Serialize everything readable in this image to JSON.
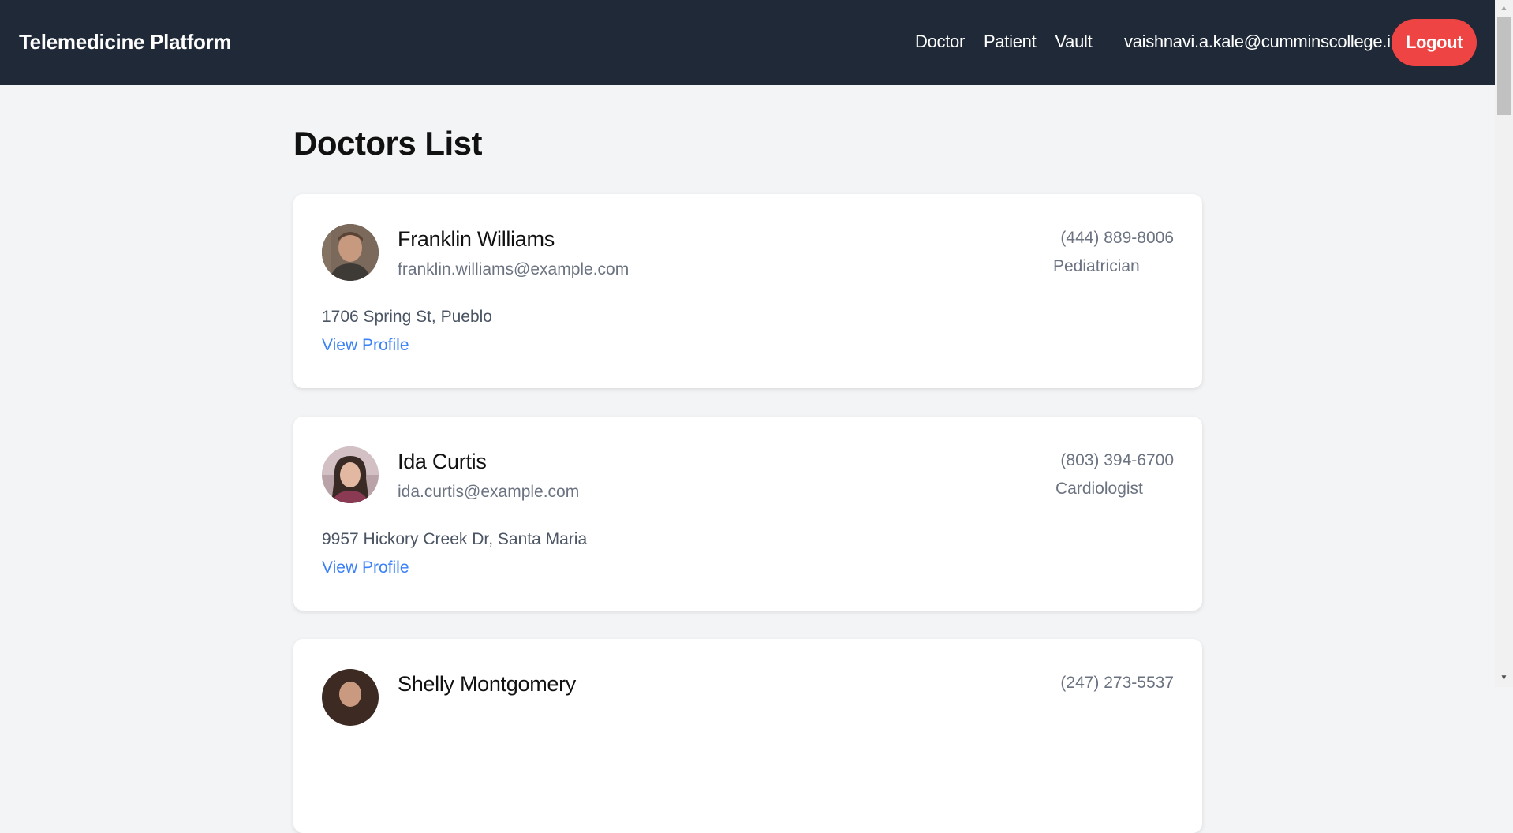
{
  "header": {
    "brand": "Telemedicine Platform",
    "nav": [
      "Doctor",
      "Patient",
      "Vault"
    ],
    "user_email": "vaishnavi.a.kale@cumminscollege.in",
    "logout_label": "Logout"
  },
  "main": {
    "title": "Doctors List",
    "link_label": "View Profile",
    "doctors": [
      {
        "name": "Franklin Williams",
        "email": "franklin.williams@example.com",
        "phone": "(444) 889-8006",
        "specialty": "Pediatrician",
        "address": "1706 Spring St, Pueblo"
      },
      {
        "name": "Ida Curtis",
        "email": "ida.curtis@example.com",
        "phone": "(803) 394-6700",
        "specialty": "Cardiologist",
        "address": "9957 Hickory Creek Dr, Santa Maria"
      },
      {
        "name": "Shelly Montgomery",
        "email": "",
        "phone": "(247) 273-5537",
        "specialty": "",
        "address": ""
      }
    ]
  },
  "colors": {
    "navbar": "#1f2937",
    "logout": "#ef4444",
    "link": "#3b82f6",
    "page_bg": "#f3f4f6"
  }
}
